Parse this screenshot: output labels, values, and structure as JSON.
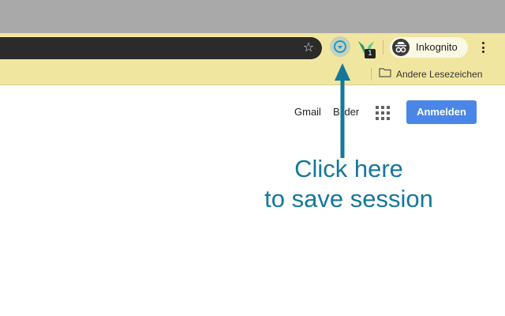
{
  "toolbar": {
    "incognito_label": "Inkognito",
    "extension_badge": "1"
  },
  "bookmarks_bar": {
    "other_bookmarks_label": "Andere Lesezeichen"
  },
  "google_header": {
    "gmail_label": "Gmail",
    "images_label": "Bilder",
    "signin_label": "Anmelden"
  },
  "annotation": {
    "line1": "Click here",
    "line2": "to save session",
    "color": "#157799"
  },
  "colors": {
    "toolbar_bg": "#f1e6a0",
    "signin_bg": "#4a86e8",
    "omnibox_bg": "#2b2b2b"
  },
  "icons": [
    "star-icon",
    "save-session-extension-icon",
    "vee-extension-icon",
    "incognito-avatar-icon",
    "menu-icon",
    "folder-icon",
    "apps-grid-icon",
    "arrow-icon"
  ]
}
